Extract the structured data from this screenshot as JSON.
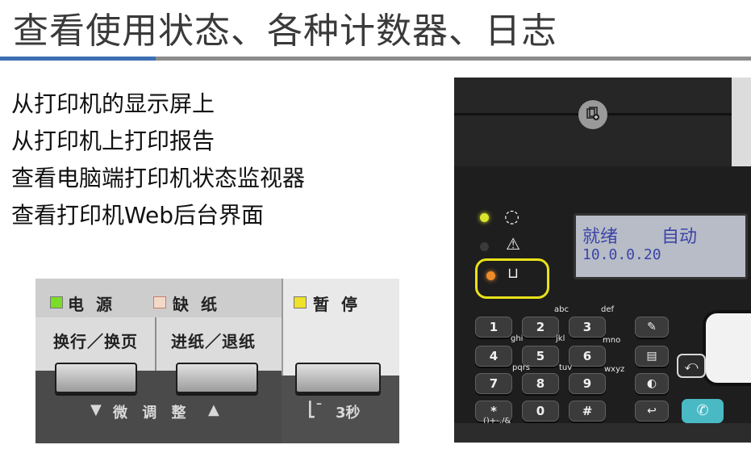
{
  "slide": {
    "title": "查看使用状态、各种计数器、日志",
    "bullets": [
      "从打印机的显示屏上",
      "从打印机上打印报告",
      "查看电脑端打印机状态监视器",
      "查看打印机Web后台界面"
    ],
    "accent_color": "#3d6fb3"
  },
  "dot_matrix_panel": {
    "power_label": "电 源",
    "paper_out_label": "缺 纸",
    "pause_label": "暂 停",
    "line_feed_button": "换行／换页",
    "load_eject_button": "进纸／退纸",
    "hint_fine_adjust": "微 调 整",
    "hint_pause_hold": "3秒",
    "power_led_color": "#7bdc2a",
    "paper_led_color": "#f3d9c8",
    "pause_led_color": "#f0e12a"
  },
  "laser_panel": {
    "lcd_line1_left": "就绪",
    "lcd_line1_right": "自动",
    "lcd_line2": "10.0.0.20",
    "keys": [
      "1",
      "2",
      "3",
      "4",
      "5",
      "6",
      "7",
      "8",
      "9",
      "*",
      "0",
      "#"
    ],
    "key_subs": [
      "abc",
      "def",
      "ghi",
      "jkl",
      "mno",
      "pqrs",
      "tuv",
      "wxyz",
      "()+-./&"
    ],
    "ready_led_color": "#d9e52a",
    "error_led_color": "#3a3a3a",
    "supply_led_color": "#ef8c2a",
    "highlight_color": "#e9e21a"
  }
}
